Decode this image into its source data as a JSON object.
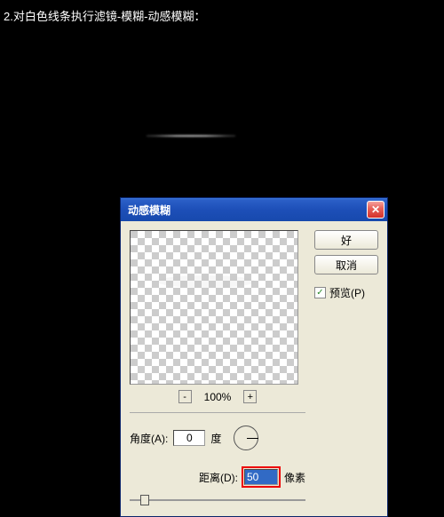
{
  "instruction": "2.对白色线条执行滤镜-模糊-动感模糊：",
  "dialog": {
    "title": "动感模糊",
    "buttons": {
      "ok": "好",
      "cancel": "取消"
    },
    "preview_check": "预览(P)",
    "zoom": {
      "minus": "-",
      "percent": "100%",
      "plus": "+"
    },
    "angle": {
      "label": "角度(A):",
      "value": "0",
      "unit": "度"
    },
    "distance": {
      "label": "距离(D):",
      "value": "50",
      "unit": "像素"
    }
  }
}
